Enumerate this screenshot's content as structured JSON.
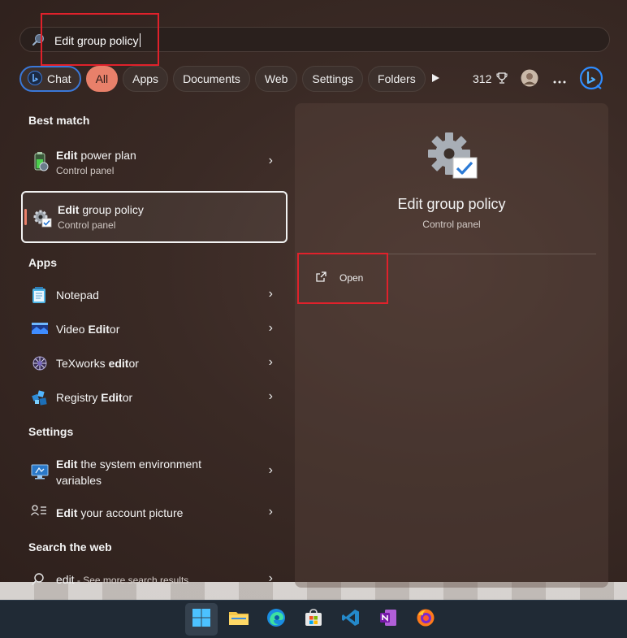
{
  "search": {
    "query": "Edit group policy"
  },
  "filters": {
    "chat": "Chat",
    "all": "All",
    "apps": "Apps",
    "documents": "Documents",
    "web": "Web",
    "settings": "Settings",
    "folders": "Folders",
    "points": "312"
  },
  "sections": {
    "best_match": "Best match",
    "apps": "Apps",
    "settings": "Settings",
    "search_web": "Search the web"
  },
  "best_match": [
    {
      "bold": "Edit",
      "rest": " power plan",
      "sub": "Control panel"
    },
    {
      "bold": "Edit",
      "rest": " group policy",
      "sub": "Control panel"
    }
  ],
  "apps": [
    {
      "pre": "Notepad",
      "bold": "",
      "post": ""
    },
    {
      "pre": "Video ",
      "bold": "Edit",
      "post": "or"
    },
    {
      "pre": "TeXworks ",
      "bold": "edit",
      "post": "or"
    },
    {
      "pre": "Registry ",
      "bold": "Edit",
      "post": "or"
    }
  ],
  "settings": [
    {
      "bold": "Edit",
      "rest": " the system environment",
      "rest2": "variables"
    },
    {
      "bold": "Edit",
      "rest": " your account picture"
    }
  ],
  "web": {
    "query": "edit",
    "suffix": " - See more search results"
  },
  "detail": {
    "title": "Edit group policy",
    "subtitle": "Control panel",
    "open": "Open"
  },
  "colors": {
    "accent": "#e8806a",
    "highlight_box": "#e0212b",
    "chat_border": "#3a78d8"
  }
}
